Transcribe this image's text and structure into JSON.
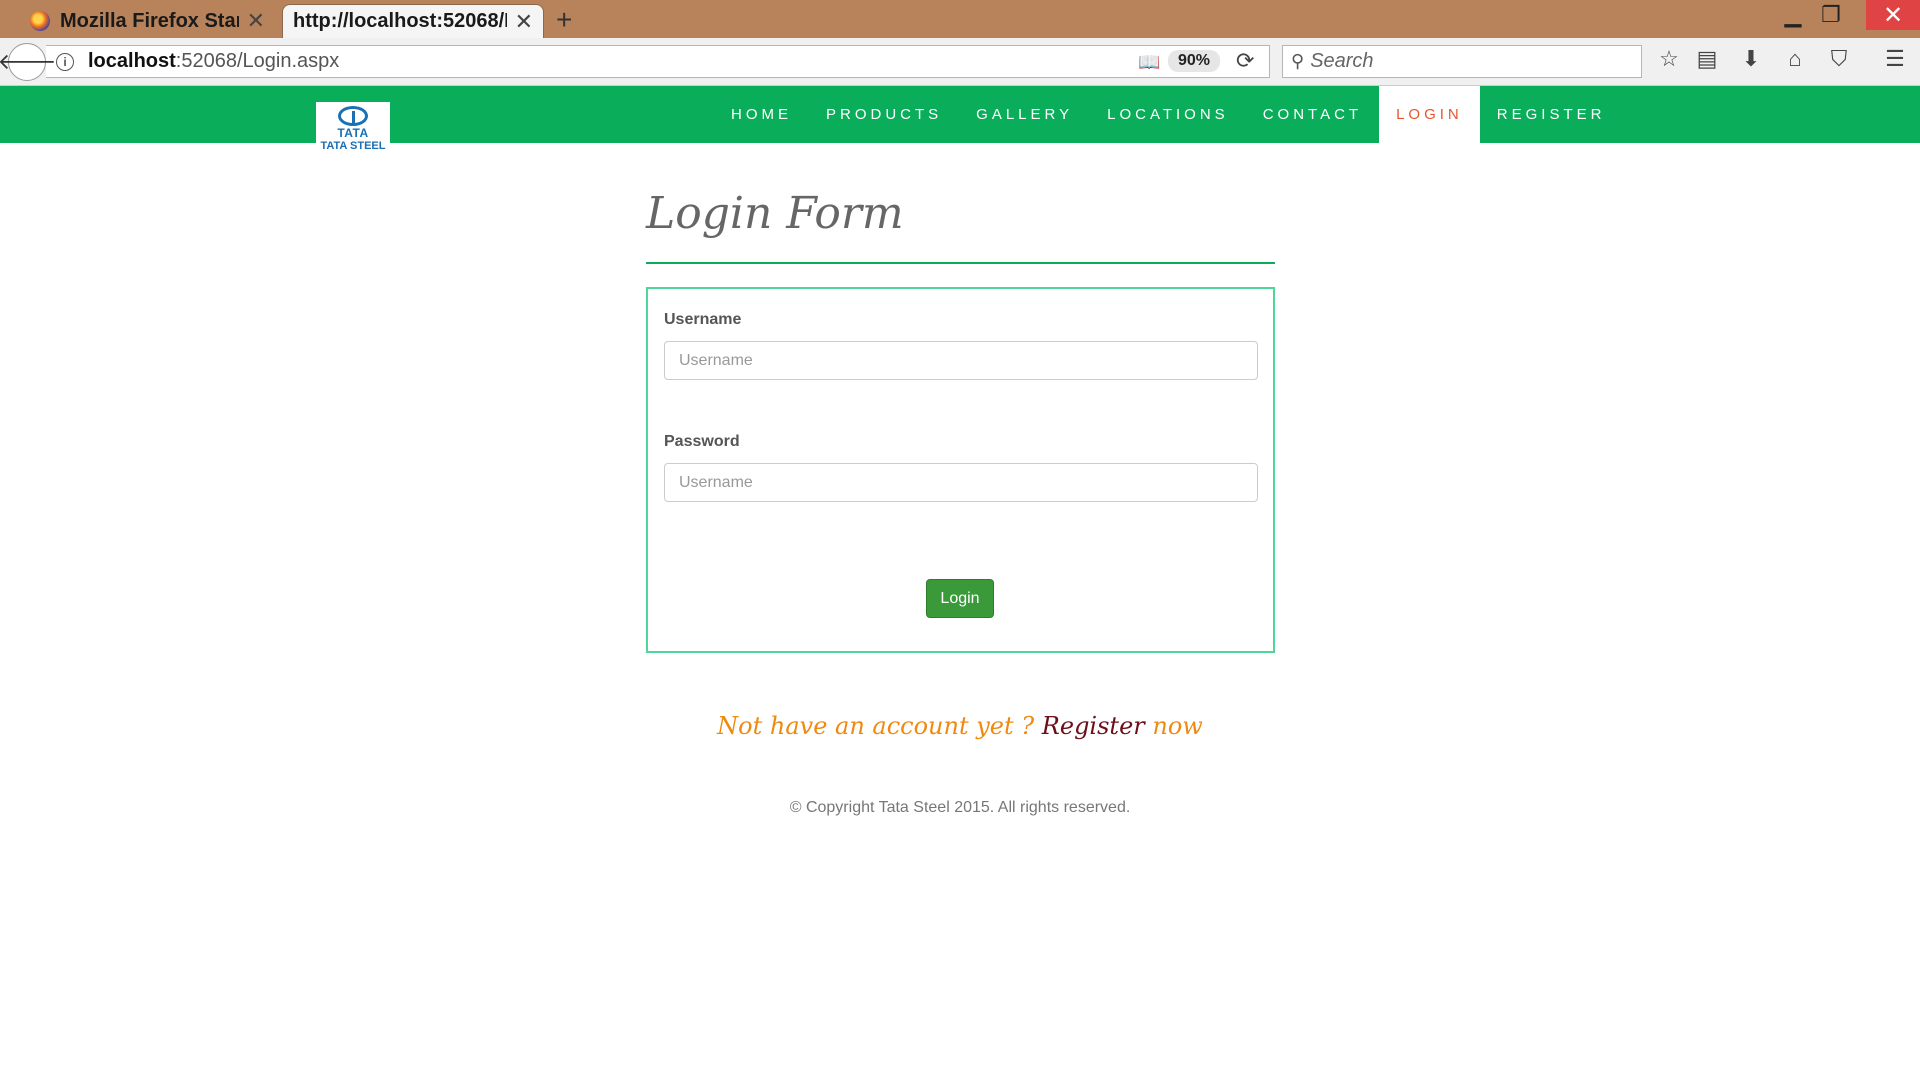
{
  "browser": {
    "tabs": [
      {
        "title": "Mozilla Firefox Start Page",
        "active": false
      },
      {
        "title": "http://localhost:52068/Login.aspx",
        "active": true
      }
    ],
    "new_tab": "+",
    "url_host": "localhost",
    "url_rest": ":52068/Login.aspx",
    "zoom": "90%",
    "search_placeholder": "Search",
    "icons": {
      "back": "back-arrow-icon",
      "info": "info-icon",
      "reader": "reader-view-icon",
      "reload": "reload-icon",
      "search": "search-icon",
      "bookmark": "bookmark-star-icon",
      "library": "library-icon",
      "downloads": "download-icon",
      "home": "home-icon",
      "pocket": "pocket-icon",
      "menu": "hamburger-menu-icon"
    }
  },
  "site": {
    "logo": {
      "tata": "TATA",
      "steel": "TATA STEEL"
    },
    "nav": [
      {
        "label": "HOME",
        "active": false
      },
      {
        "label": "PRODUCTS",
        "active": false
      },
      {
        "label": "GALLERY",
        "active": false
      },
      {
        "label": "LOCATIONS",
        "active": false
      },
      {
        "label": "CONTACT",
        "active": false
      },
      {
        "label": "LOGIN",
        "active": true
      },
      {
        "label": "REGISTER",
        "active": false
      }
    ],
    "colors": {
      "nav_bg": "#0aad5a",
      "active_link": "#e8542e",
      "button": "#3a9a3a"
    }
  },
  "form": {
    "title": "Login Form",
    "username_label": "Username",
    "username_placeholder": "Username",
    "password_label": "Password",
    "password_placeholder": "Username",
    "submit_label": "Login"
  },
  "register_prompt": {
    "prefix": "Not have an account yet ?",
    "link": "Register",
    "suffix": "now"
  },
  "footer": {
    "copyright": "© Copyright Tata Steel 2015. All rights reserved."
  }
}
